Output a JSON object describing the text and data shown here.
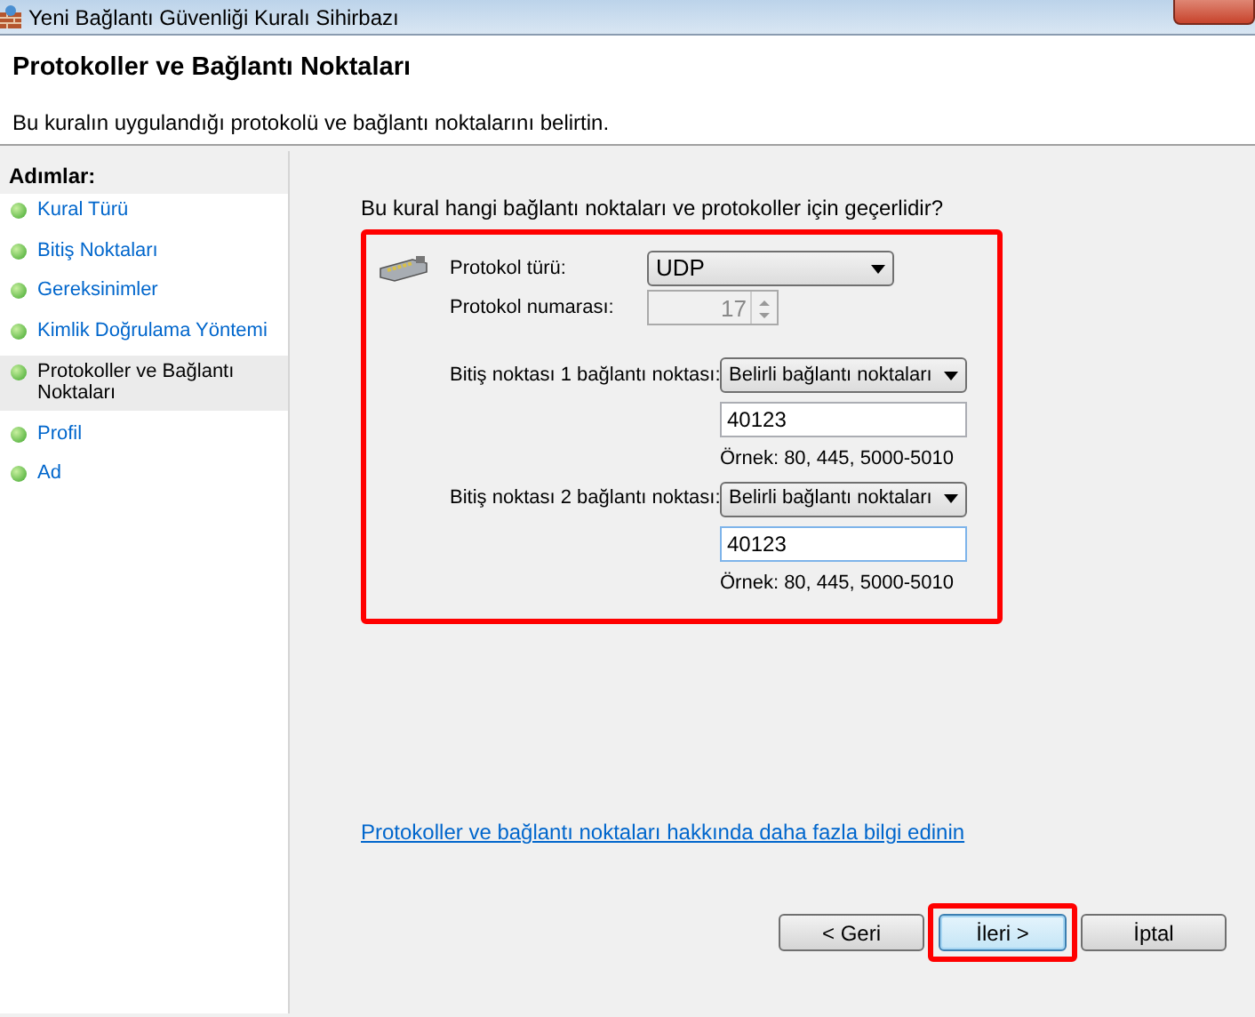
{
  "window": {
    "title": "Yeni Bağlantı Güvenliği Kuralı Sihirbazı"
  },
  "header": {
    "title": "Protokoller ve Bağlantı Noktaları",
    "subtitle": "Bu kuralın uygulandığı protokolü ve bağlantı noktalarını belirtin."
  },
  "sidebar": {
    "heading": "Adımlar:",
    "items": [
      {
        "label": "Kural Türü",
        "selected": false
      },
      {
        "label": "Bitiş Noktaları",
        "selected": false
      },
      {
        "label": "Gereksinimler",
        "selected": false
      },
      {
        "label": "Kimlik Doğrulama Yöntemi",
        "selected": false
      },
      {
        "label": "Protokoller ve Bağlantı Noktaları",
        "selected": true
      },
      {
        "label": "Profil",
        "selected": false
      },
      {
        "label": "Ad",
        "selected": false
      }
    ]
  },
  "main": {
    "question": "Bu kural hangi bağlantı noktaları ve protokoller için geçerlidir?",
    "group": {
      "highlighted": true,
      "protocol_type": {
        "label": "Protokol türü:",
        "value": "UDP"
      },
      "protocol_number": {
        "label": "Protokol numarası:",
        "value": "17",
        "disabled": true
      },
      "endpoints": [
        {
          "label": "Bitiş noktası 1 bağlantı noktası:",
          "value": "Belirli bağlantı noktaları",
          "ports": "40123",
          "example": "Örnek: 80, 445, 5000-5010",
          "focused": false
        },
        {
          "label": "Bitiş noktası 2 bağlantı noktası:",
          "value": "Belirli bağlantı noktaları",
          "ports": "40123",
          "example": "Örnek: 80, 445, 5000-5010",
          "focused": true
        }
      ]
    },
    "link": "Protokoller ve bağlantı noktaları hakkında daha fazla bilgi edinin"
  },
  "buttons": [
    {
      "label": "< Geri",
      "highlighted": false,
      "default": false
    },
    {
      "label": "İleri >",
      "highlighted": true,
      "default": true
    },
    {
      "label": "İptal",
      "highlighted": false,
      "default": false
    }
  ]
}
